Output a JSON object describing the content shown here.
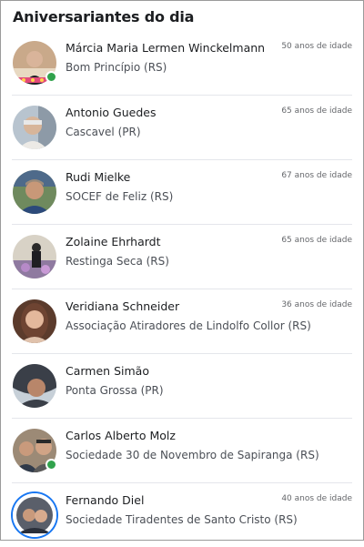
{
  "title": "Aniversariantes do dia",
  "people": [
    {
      "name": "Márcia Maria Lermen Winckelmann",
      "place": "Bom Princípio (RS)",
      "age": "50 anos de idade",
      "online": true,
      "avatar_bg": "#c9a98a"
    },
    {
      "name": "Antonio Guedes",
      "place": "Cascavel (PR)",
      "age": "65 anos de idade",
      "online": false,
      "avatar_bg": "#a9b5c2"
    },
    {
      "name": "Rudi Mielke",
      "place": "SOCEF de Feliz (RS)",
      "age": "67 anos de idade",
      "online": false,
      "avatar_bg": "#7a8a6a"
    },
    {
      "name": "Zolaine Ehrhardt",
      "place": "Restinga Seca (RS)",
      "age": "65 anos de idade",
      "online": false,
      "avatar_bg": "#9c8fa8"
    },
    {
      "name": "Veridiana Schneider",
      "place": "Associação Atiradores de Lindolfo Collor (RS)",
      "age": "36 anos de idade",
      "online": false,
      "avatar_bg": "#6b4a3a"
    },
    {
      "name": "Carmen Simão",
      "place": "Ponta Grossa (PR)",
      "age": "",
      "online": false,
      "avatar_bg": "#3f4650"
    },
    {
      "name": "Carlos Alberto Molz",
      "place": "Sociedade 30 de Novembro  de Sapiranga (RS)",
      "age": "",
      "online": true,
      "avatar_bg": "#8a7a6a"
    },
    {
      "name": "Fernando Diel",
      "place": "Sociedade Tiradentes de Santo Cristo (RS)",
      "age": "40 anos de idade",
      "online": false,
      "avatar_bg": "#5a5f6a",
      "story_ring": true
    }
  ],
  "colors": {
    "online": "#31a24c",
    "ring": "#1877f2",
    "divider": "#e4e6eb"
  }
}
